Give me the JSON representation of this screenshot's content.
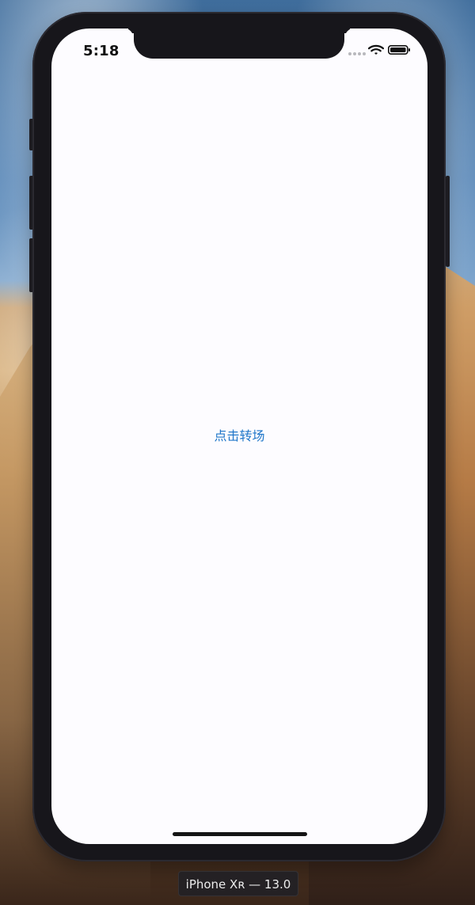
{
  "status_bar": {
    "time": "5:18"
  },
  "screen": {
    "transition_link": "点击转场"
  },
  "footer": {
    "device_label": "iPhone Xʀ — 13.0"
  },
  "colors": {
    "link": "#1f76c9",
    "screen_background": "#fdfcff"
  }
}
